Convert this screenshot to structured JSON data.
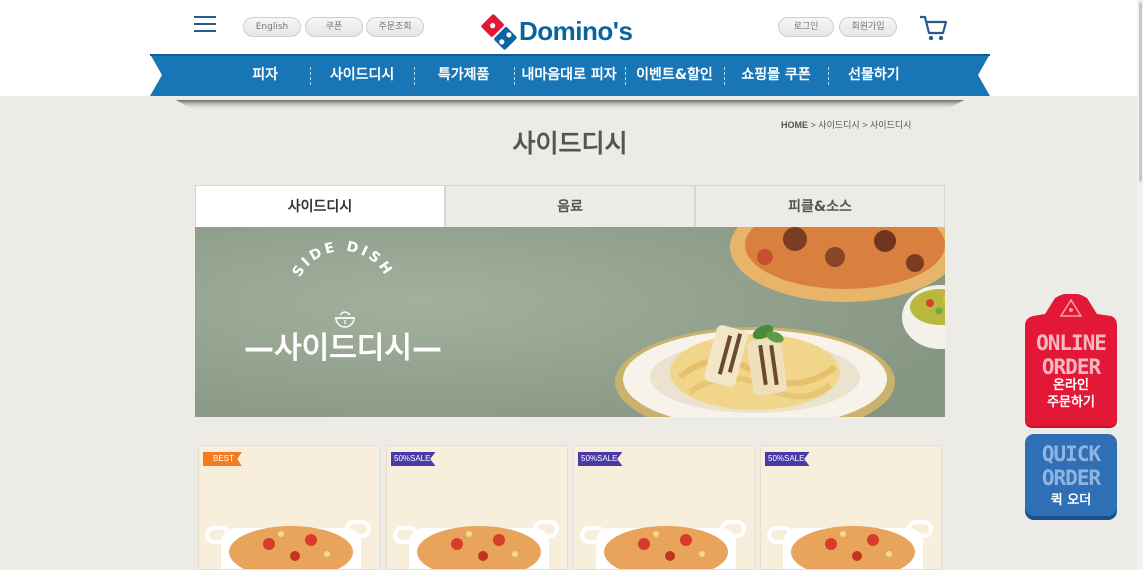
{
  "header": {
    "top_links": [
      "English",
      "쿠폰",
      "주문조회"
    ],
    "logo_text": "Domino's",
    "account_links": [
      "로그인",
      "회원가입"
    ]
  },
  "nav": {
    "items": [
      "피자",
      "사이드디시",
      "특가제품",
      "내마음대로 피자",
      "이벤트&할인",
      "쇼핑몰 쿠폰",
      "선물하기"
    ]
  },
  "breadcrumb": {
    "home": "HOME",
    "sep1": ">",
    "level1": "사이드디시",
    "sep2": ">",
    "level2": "사이드디시"
  },
  "page_title": "사이드디시",
  "tabs": [
    {
      "label": "사이드디시",
      "active": true
    },
    {
      "label": "음료",
      "active": false
    },
    {
      "label": "피클&소스",
      "active": false
    }
  ],
  "banner": {
    "arc_text": "SIDE DISH",
    "main_text": "—사이드디시—"
  },
  "products": [
    {
      "badge": "BEST",
      "badge_type": "best"
    },
    {
      "badge": "50%SALE",
      "badge_type": "sale"
    },
    {
      "badge": "50%SALE",
      "badge_type": "sale"
    },
    {
      "badge": "50%SALE",
      "badge_type": "sale"
    }
  ],
  "floating": {
    "online_big": [
      "ONLINE",
      "ORDER"
    ],
    "online_small": [
      "온라인",
      "주문하기"
    ],
    "quick_big": [
      "QUICK",
      "ORDER"
    ],
    "quick_small": "퀵 오더"
  },
  "colors": {
    "brand_blue": "#0b64a0",
    "brand_red": "#e31837",
    "nav_blue": "#1876b6",
    "background": "#ecebe6"
  }
}
